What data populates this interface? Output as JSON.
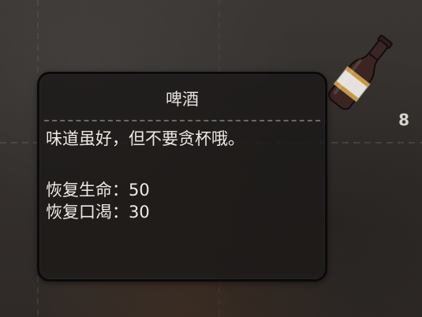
{
  "tooltip": {
    "title": "啤酒",
    "description": "味道虽好，但不要贪杯哦。",
    "stats": [
      {
        "label": "恢复生命：",
        "value": "50"
      },
      {
        "label": "恢复口渴：",
        "value": "30"
      }
    ]
  },
  "item": {
    "icon": "beer-bottle-icon",
    "count": "8"
  },
  "colors": {
    "background": "#34302d",
    "tooltip_background": "#1c1a19",
    "tooltip_border": "#0b0a0a",
    "text": "#eeeae4",
    "divider": "#6e6864",
    "bottle": "#3a2522",
    "label_band": "#e4e1de"
  }
}
